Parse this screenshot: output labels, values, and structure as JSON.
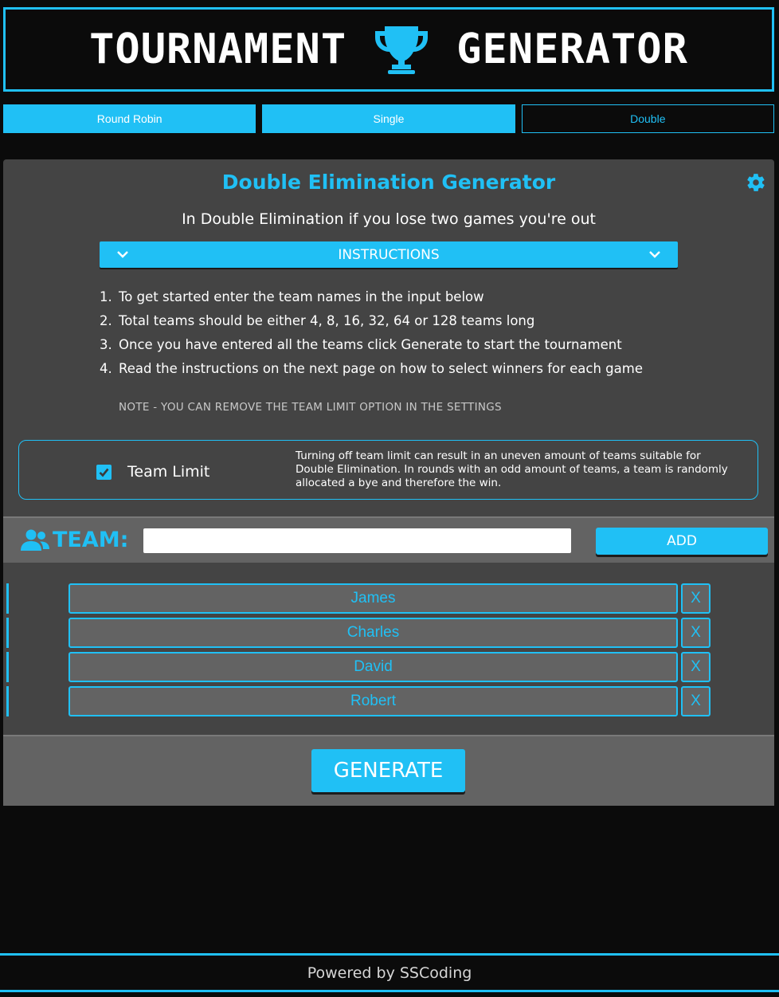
{
  "header": {
    "title_left": "TOURNAMENT",
    "title_right": "GENERATOR",
    "icon": "trophy-icon"
  },
  "tabs": [
    {
      "label": "Round Robin",
      "active": false
    },
    {
      "label": "Single",
      "active": false
    },
    {
      "label": "Double",
      "active": true
    }
  ],
  "panel": {
    "title": "Double Elimination Generator",
    "settings_icon": "gear-icon",
    "subtitle": "In Double Elimination if you lose two games you're out",
    "instructions_label": "INSTRUCTIONS",
    "steps": [
      {
        "num": "1.",
        "text": "To get started enter the team names in the input below"
      },
      {
        "num": "2.",
        "text": "Total teams should be either 4, 8, 16, 32, 64 or 128 teams long"
      },
      {
        "num": "3.",
        "text": "Once you have entered all the teams click Generate to start the tournament"
      },
      {
        "num": "4.",
        "text": "Read the instructions on the next page on how to select winners for each game"
      }
    ],
    "note": "NOTE - YOU CAN REMOVE THE TEAM LIMIT OPTION IN THE SETTINGS"
  },
  "team_limit": {
    "checked": true,
    "label": "Team Limit",
    "description": "Turning off team limit can result in an uneven amount of teams suitable for Double Elimination. In rounds with an odd amount of teams, a team is randomly allocated a bye and therefore the win."
  },
  "team_input": {
    "label": "TEAM:",
    "icon": "users-icon",
    "value": "",
    "placeholder": "",
    "add_label": "ADD"
  },
  "teams": [
    {
      "name": "James",
      "remove_label": "X"
    },
    {
      "name": "Charles",
      "remove_label": "X"
    },
    {
      "name": "David",
      "remove_label": "X"
    },
    {
      "name": "Robert",
      "remove_label": "X"
    }
  ],
  "generate_label": "GENERATE",
  "footer": {
    "text": "Powered by SSCoding"
  },
  "colors": {
    "accent": "#20c0f5",
    "panel": "#444444",
    "bar": "#636363",
    "background": "#0b0b0b"
  }
}
